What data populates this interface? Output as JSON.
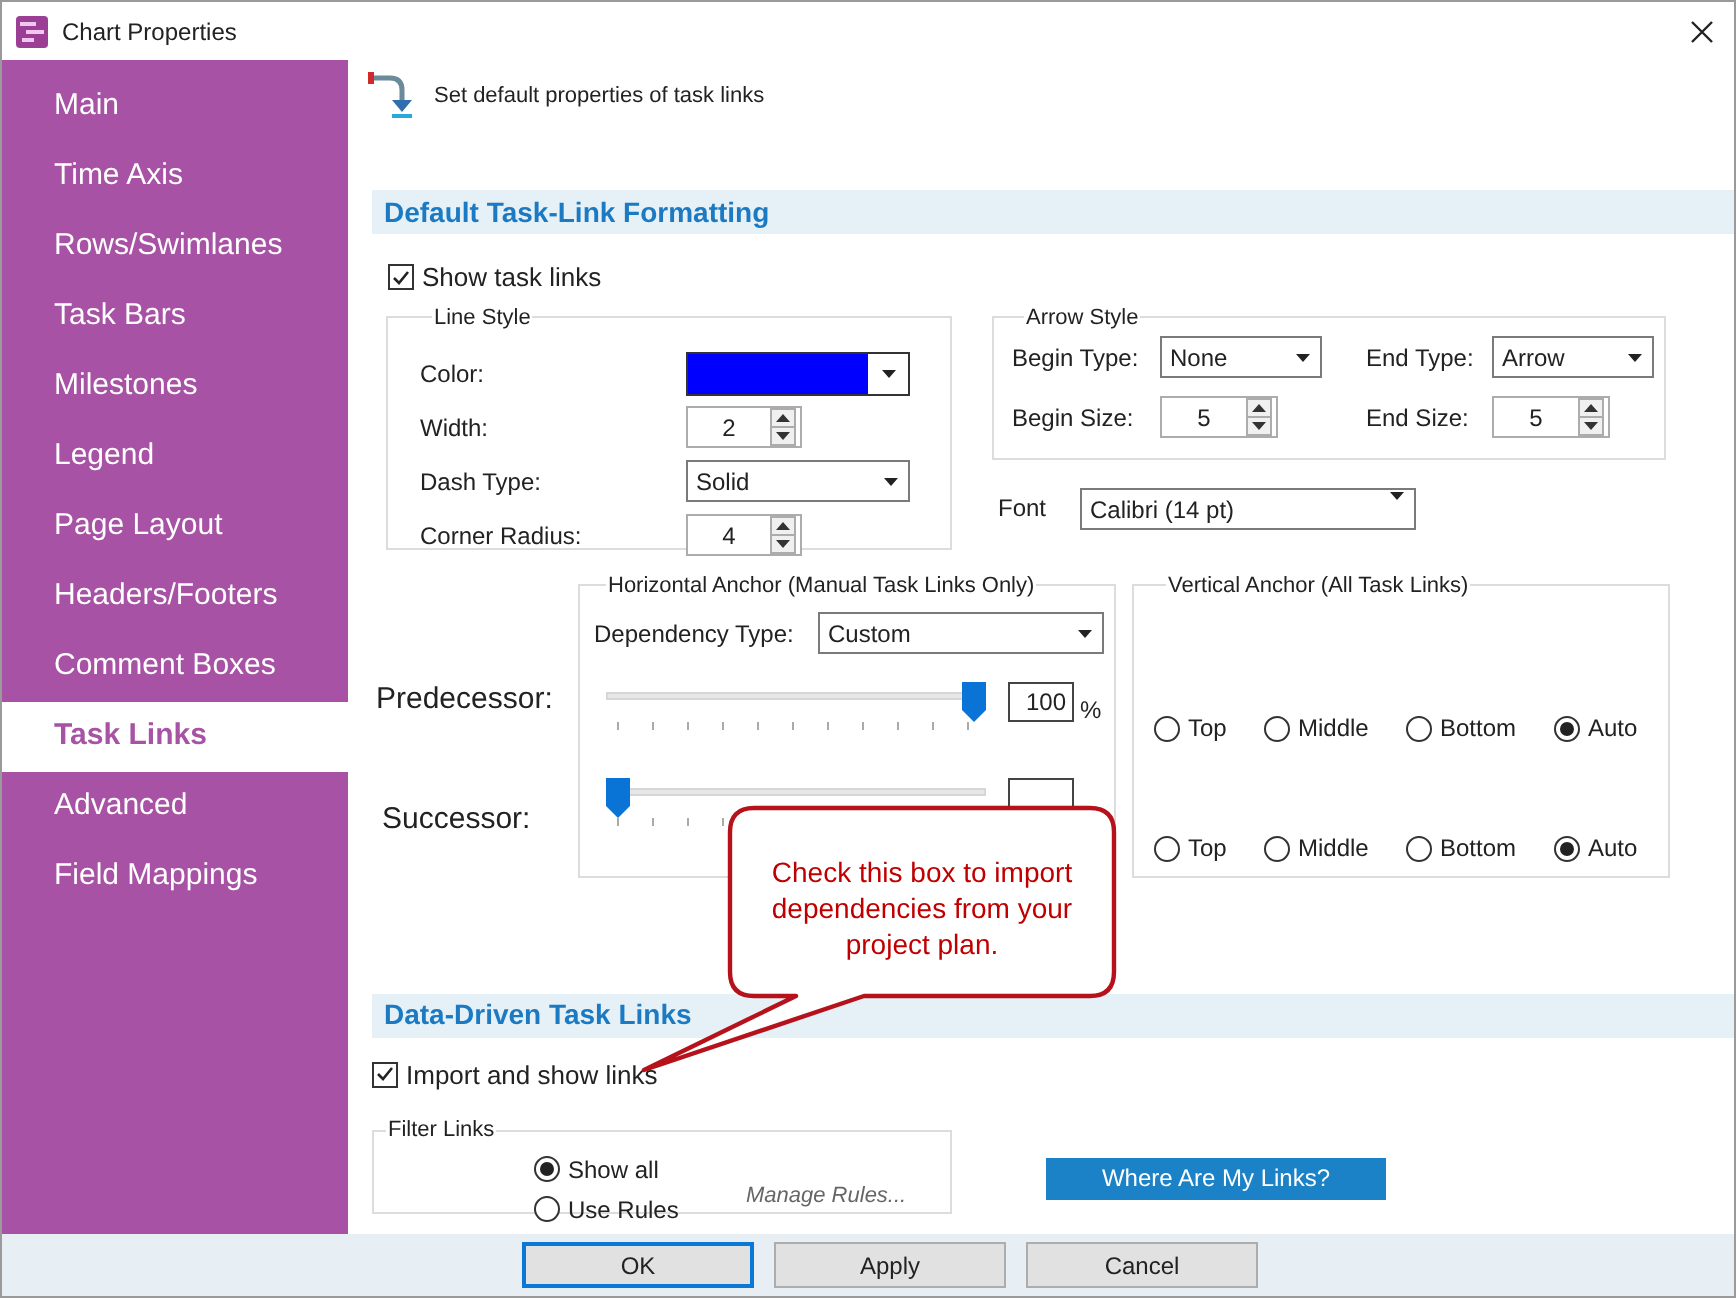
{
  "window": {
    "title": "Chart Properties"
  },
  "sidebar": {
    "items": [
      {
        "label": "Main",
        "selected": false
      },
      {
        "label": "Time Axis",
        "selected": false
      },
      {
        "label": "Rows/Swimlanes",
        "selected": false
      },
      {
        "label": "Task Bars",
        "selected": false
      },
      {
        "label": "Milestones",
        "selected": false
      },
      {
        "label": "Legend",
        "selected": false
      },
      {
        "label": "Page Layout",
        "selected": false
      },
      {
        "label": "Headers/Footers",
        "selected": false
      },
      {
        "label": "Comment Boxes",
        "selected": false
      },
      {
        "label": "Task Links",
        "selected": true
      },
      {
        "label": "Advanced",
        "selected": false
      },
      {
        "label": "Field Mappings",
        "selected": false
      }
    ]
  },
  "header": {
    "text": "Set default properties of task links"
  },
  "default_section": {
    "title": "Default Task-Link Formatting",
    "show_task_links": {
      "label": "Show task links",
      "checked": true
    },
    "line_style": {
      "title": "Line Style",
      "rows": [
        {
          "kind": "color",
          "label": "Color:",
          "color": "#0000ff"
        },
        {
          "kind": "spin",
          "label": "Width:",
          "value": "2"
        },
        {
          "kind": "dropdown",
          "label": "Dash Type:",
          "value": "Solid"
        },
        {
          "kind": "spin",
          "label": "Corner Radius:",
          "value": "4"
        }
      ]
    },
    "arrow_style": {
      "title": "Arrow Style",
      "fields": [
        {
          "kind": "dropdown",
          "label": "Begin Type:",
          "value": "None"
        },
        {
          "kind": "dropdown",
          "label": "End Type:",
          "value": "Arrow"
        },
        {
          "kind": "spin",
          "label": "Begin Size:",
          "value": "5"
        },
        {
          "kind": "spin",
          "label": "End Size:",
          "value": "5"
        }
      ]
    },
    "font": {
      "label": "Font",
      "value": "Calibri (14 pt)"
    },
    "horizontal_anchor": {
      "title": "Horizontal Anchor (Manual Task Links Only)",
      "dependency_type": {
        "label": "Dependency Type:",
        "value": "Custom"
      }
    },
    "vertical_anchor": {
      "title": "Vertical Anchor (All Task Links)"
    },
    "anchors": [
      {
        "label": "Predecessor:",
        "level": 1,
        "value": "100",
        "unit": "%",
        "options": [
          {
            "label": "Top",
            "selected": false
          },
          {
            "label": "Middle",
            "selected": false
          },
          {
            "label": "Bottom",
            "selected": false
          },
          {
            "label": "Auto",
            "selected": true
          }
        ]
      },
      {
        "label": "Successor:",
        "level": 0,
        "options": [
          {
            "label": "Top",
            "selected": false
          },
          {
            "label": "Middle",
            "selected": false
          },
          {
            "label": "Bottom",
            "selected": false
          },
          {
            "label": "Auto",
            "selected": true
          }
        ]
      }
    ]
  },
  "callout": {
    "text": "Check this box to import dependencies from your project plan."
  },
  "data_section": {
    "title": "Data-Driven Task Links",
    "import_links": {
      "label": "Import and show links",
      "checked": true
    },
    "filter_links": {
      "title": "Filter Links",
      "options": [
        {
          "label": "Show all",
          "selected": true
        },
        {
          "label": "Use Rules",
          "selected": false
        }
      ],
      "manage_rules": "Manage Rules..."
    },
    "help_button": "Where Are My Links?"
  },
  "buttons": [
    {
      "label": "OK",
      "default": true
    },
    {
      "label": "Apply",
      "default": false
    },
    {
      "label": "Cancel",
      "default": false
    }
  ]
}
